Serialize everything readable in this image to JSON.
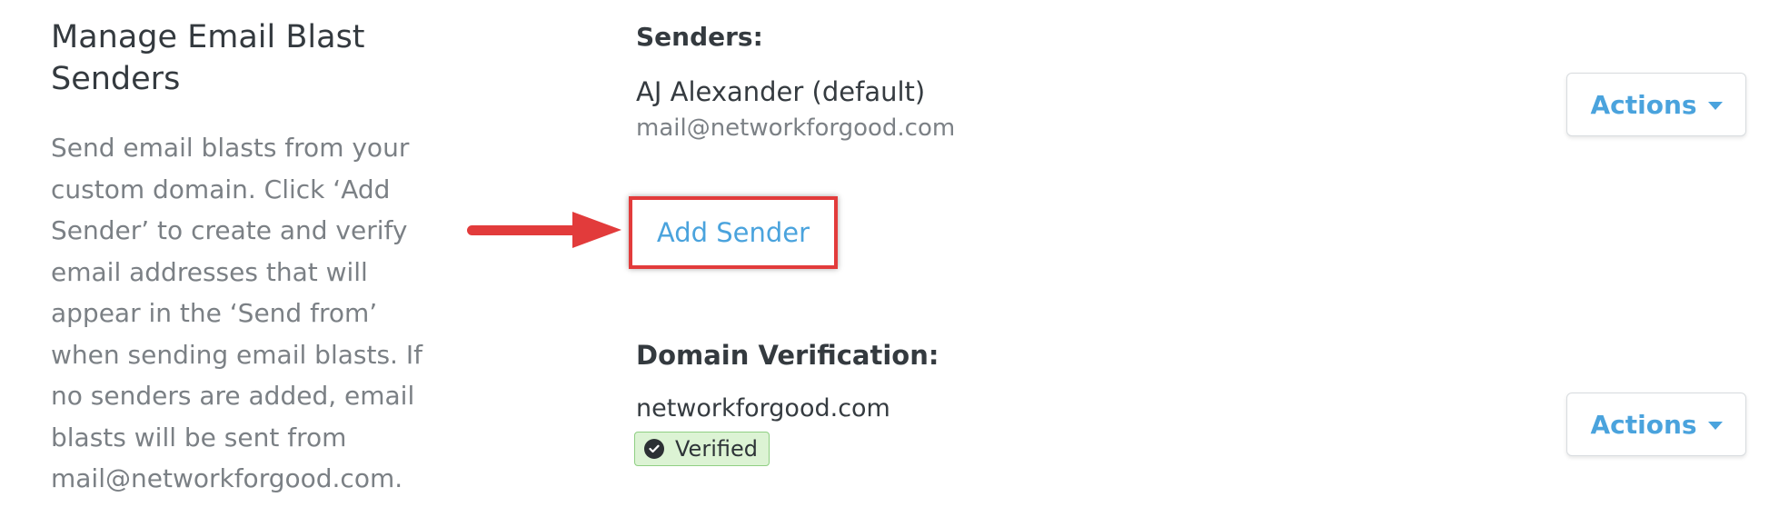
{
  "left": {
    "title": "Manage Email Blast Senders",
    "description": "Send email blasts from your custom domain. Click ‘Add Sender’ to create and verify email addresses that will appear in the ‘Send from’ when sending email blasts. If no senders are added, email blasts will be sent from mail@networkforgood.com."
  },
  "senders": {
    "label": "Senders:",
    "items": [
      {
        "name": "AJ Alexander (default)",
        "email": "mail@networkforgood.com",
        "actions_label": "Actions"
      }
    ],
    "add_label": "Add Sender"
  },
  "domain": {
    "label": "Domain Verification:",
    "name": "networkforgood.com",
    "status": "Verified",
    "actions_label": "Actions"
  },
  "colors": {
    "accent": "#4aa3dd",
    "highlight": "#e23b3b",
    "verified_bg": "#dcf3d4"
  },
  "icons": [
    "chevron-down-icon",
    "check-circle-icon",
    "red-arrow-icon"
  ]
}
